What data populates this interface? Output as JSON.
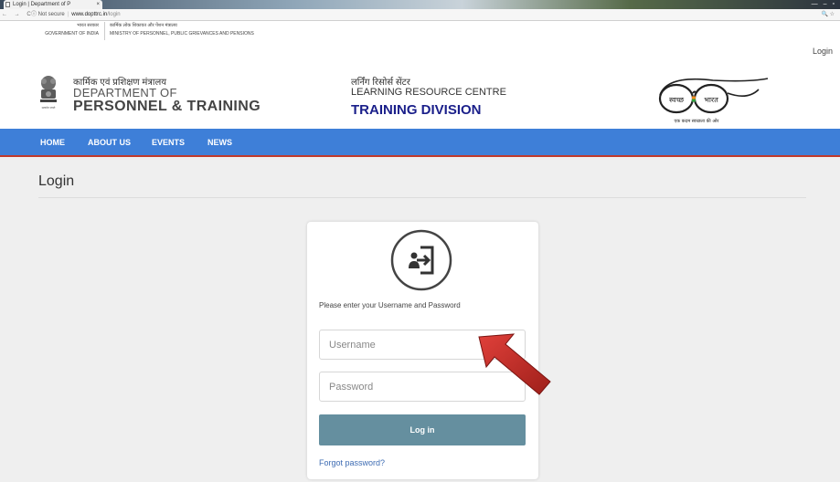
{
  "browser": {
    "tab_title": "Login | Department of P",
    "tab_close": "×",
    "window_controls": [
      "—",
      "–",
      "▫"
    ],
    "nav_glyphs": "← → C",
    "security_label": "ⓘ Not secure",
    "url_host": "www.dopttrc.in",
    "url_path": "/login",
    "omni_icons": "🔍 ☆"
  },
  "gov_bar": {
    "hindi_gov": "भारत सरकार",
    "gov_english": "GOVERNMENT OF INDIA",
    "hindi_ministry": "कार्मिक लोक शिकायत और पेंशन मंत्रालय",
    "ministry_english": "MINISTRY OF PERSONNEL, PUBLIC GRIEVANCES AND PENSIONS",
    "login_link": "Login"
  },
  "header": {
    "dept_hindi": "कार्मिक एवं प्रशिक्षण मंत्रालय",
    "dept_line2": "DEPARTMENT OF",
    "dept_line3": "PERSONNEL & TRAINING",
    "emblem_caption": "सत्यमेव जयते",
    "lrc_hindi": "लर्निंग रिसोर्स सेंटर",
    "lrc_line2": "LEARNING RESOURCE CENTRE",
    "lrc_line3": "TRAINING DIVISION",
    "swachh_left": "स्वच्छ",
    "swachh_right": "भारत",
    "swachh_tagline": "एक कदम स्वच्छता की ओर"
  },
  "nav": {
    "items": [
      "HOME",
      "ABOUT US",
      "EVENTS",
      "NEWS"
    ]
  },
  "page": {
    "title": "Login"
  },
  "login_card": {
    "instruction": "Please enter your Username and Password",
    "username_placeholder": "Username",
    "password_placeholder": "Password",
    "login_button": "Log in",
    "forgot_link": "Forgot password?"
  },
  "colors": {
    "nav_bg": "#3e7fd8",
    "nav_border": "#c0392b",
    "login_button": "#658f9f",
    "training_division": "#1a1f8a",
    "arrow": "#c0302a"
  }
}
